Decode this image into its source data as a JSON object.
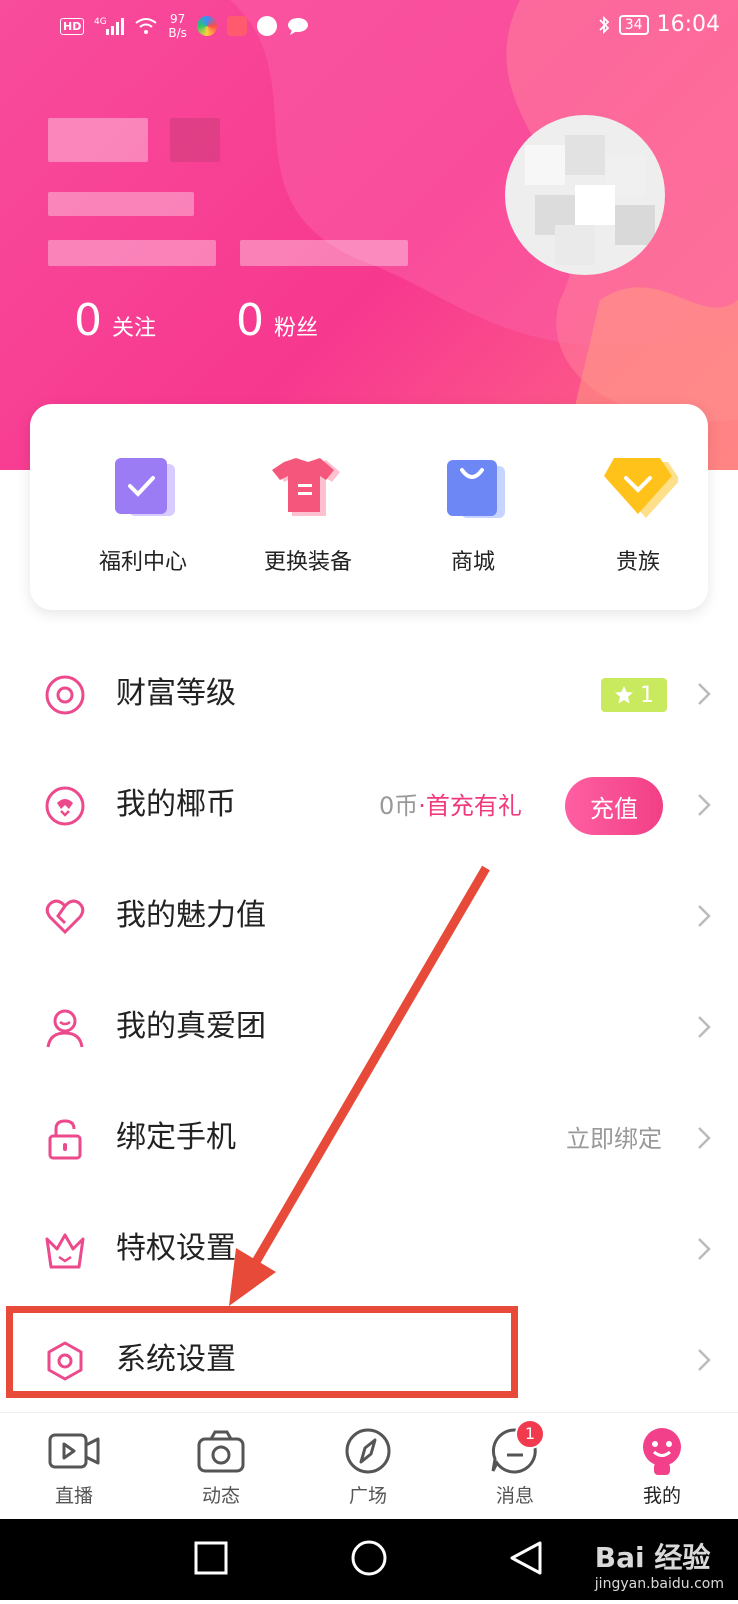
{
  "status_bar": {
    "hd": "HD",
    "net_speed_value": "97",
    "net_speed_unit": "B/s",
    "battery": "34",
    "time": "16:04"
  },
  "profile": {
    "follow_count": "0",
    "follow_label": "关注",
    "fans_count": "0",
    "fans_label": "粉丝"
  },
  "quick_actions": [
    {
      "label": "福利中心",
      "icon": "check-icon"
    },
    {
      "label": "更换装备",
      "icon": "shirt-icon"
    },
    {
      "label": "商城",
      "icon": "shopping-bag-icon"
    },
    {
      "label": "贵族",
      "icon": "diamond-icon"
    }
  ],
  "menu": {
    "wealth_level": {
      "label": "财富等级",
      "stars": "1"
    },
    "my_coins": {
      "label": "我的椰币",
      "balance": "0币",
      "dot": "·",
      "promo": "首充有礼",
      "recharge_label": "充值"
    },
    "charm": {
      "label": "我的魅力值"
    },
    "fan_group": {
      "label": "我的真爱团"
    },
    "bind_phone": {
      "label": "绑定手机",
      "action": "立即绑定"
    },
    "privilege": {
      "label": "特权设置"
    },
    "system_settings": {
      "label": "系统设置"
    }
  },
  "tabbar": [
    {
      "label": "直播",
      "icon": "video-icon"
    },
    {
      "label": "动态",
      "icon": "camera-icon"
    },
    {
      "label": "广场",
      "icon": "compass-icon"
    },
    {
      "label": "消息",
      "icon": "message-icon",
      "badge": "1"
    },
    {
      "label": "我的",
      "icon": "profile-face-icon"
    }
  ],
  "watermark": {
    "brand": "Bai 经验",
    "url": "jingyan.baidu.com"
  },
  "colors": {
    "accent": "#f23f86",
    "annotation": "#e84a3a",
    "star_badge": "#c9ea5f"
  }
}
